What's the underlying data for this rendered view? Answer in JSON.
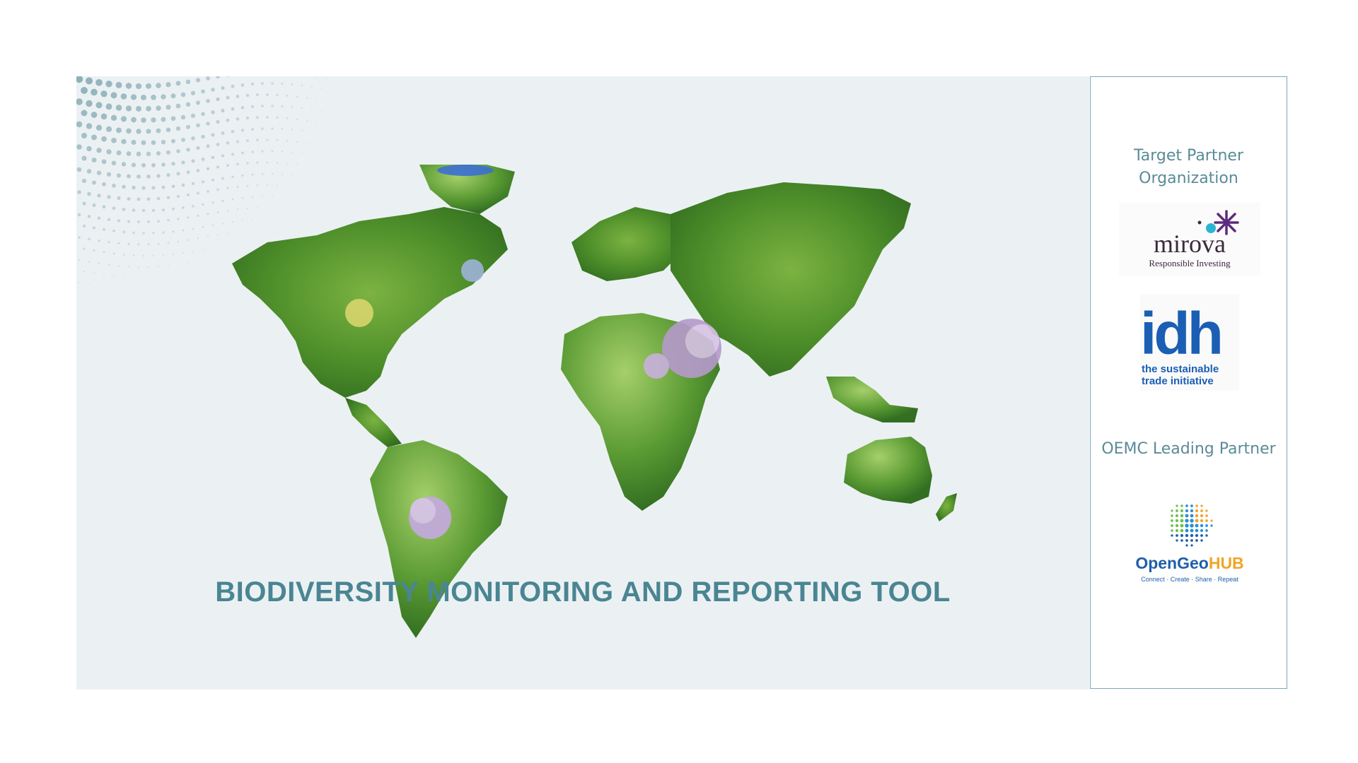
{
  "banner": {
    "title": "BIODIVERSITY MONITORING AND REPORTING TOOL"
  },
  "panel": {
    "target_label": "Target Partner Organization",
    "leading_label": "OEMC Leading Partner",
    "logos": {
      "mirova": {
        "name": "mirova",
        "tagline": "Responsible Investing"
      },
      "idh": {
        "name": "idh",
        "tagline_line1": "the sustainable",
        "tagline_line2": "trade initiative"
      },
      "opengeohub": {
        "name_part1": "Open",
        "name_part2": "Geo",
        "name_part3": "HUB",
        "tagline": "Connect · Create · Share · Repeat"
      }
    }
  },
  "colors": {
    "accent": "#4a8592",
    "background": "#ebf1f3",
    "border": "#7aa7bd",
    "idh_blue": "#1a5fb4",
    "mirova_purple": "#5e2a7e",
    "mirova_cyan": "#2cb5d3",
    "ogh_blue": "#1f5fa8",
    "ogh_orange": "#f1a428"
  }
}
